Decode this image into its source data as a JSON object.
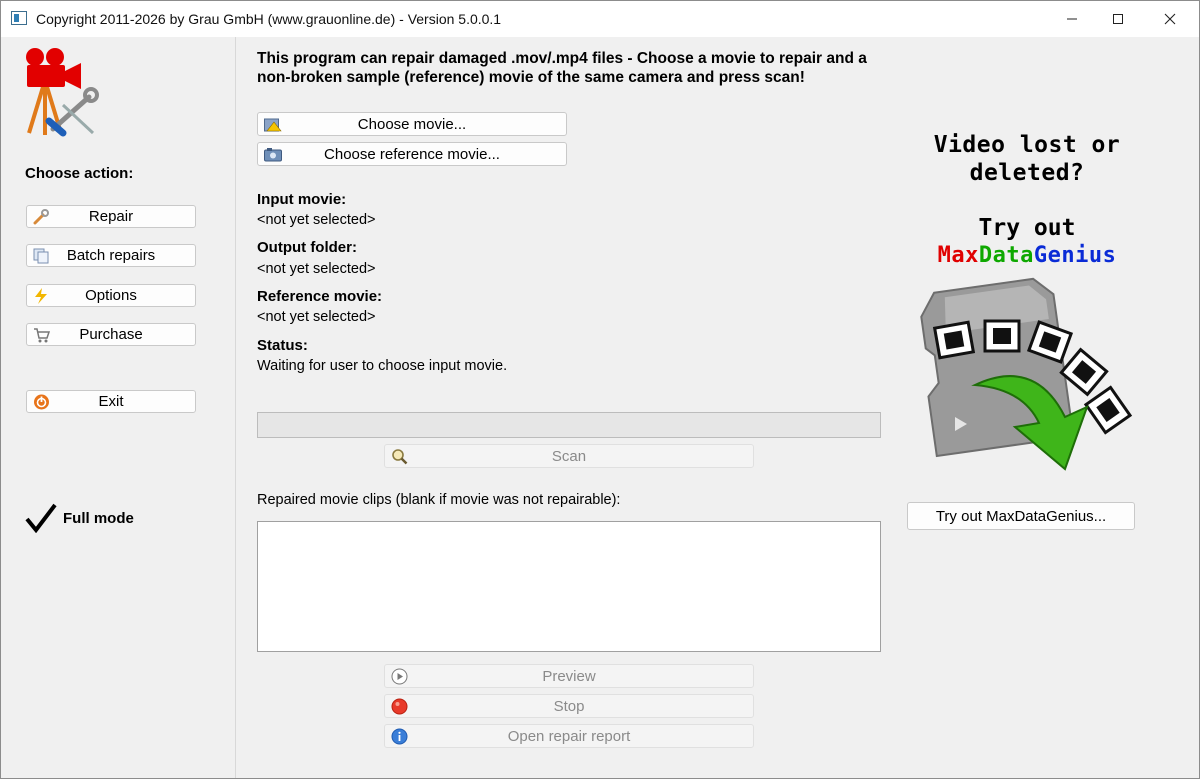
{
  "window": {
    "title": "Copyright 2011-2026 by Grau GmbH (www.grauonline.de) - Version 5.0.0.1",
    "controls": [
      "minimize",
      "maximize",
      "close"
    ]
  },
  "sidebar": {
    "logo_icon": "camera-tools-logo-icon",
    "choose_action_label": "Choose action:",
    "buttons": [
      {
        "label": "Repair",
        "icon": "wrench-icon"
      },
      {
        "label": "Batch repairs",
        "icon": "documents-stack-icon"
      },
      {
        "label": "Options",
        "icon": "lightning-icon"
      },
      {
        "label": "Purchase",
        "icon": "shopping-cart-icon"
      }
    ],
    "exit": {
      "label": "Exit",
      "icon": "power-icon"
    },
    "mode": {
      "label": "Full mode",
      "icon": "checkmark-icon"
    }
  },
  "main": {
    "intro": "This program can repair damaged .mov/.mp4 files - Choose a movie to repair and a non-broken sample (reference) movie of the same camera and press scan!",
    "choose_movie_label": "Choose movie...",
    "choose_reference_label": "Choose reference movie...",
    "fields": [
      {
        "label": "Input movie:",
        "value": "<not yet selected>"
      },
      {
        "label": "Output folder:",
        "value": "<not yet selected>"
      },
      {
        "label": "Reference movie:",
        "value": "<not yet selected>"
      },
      {
        "label": "Status:",
        "value": "Waiting for user to choose input movie."
      }
    ],
    "progress": 0,
    "scan_label": "Scan",
    "clips_label": "Repaired movie clips (blank if movie was not repairable):",
    "clips": [],
    "preview_label": "Preview",
    "stop_label": "Stop",
    "open_report_label": "Open repair report"
  },
  "promo": {
    "headline_line1": "Video lost or",
    "headline_line2": "deleted?",
    "try_out": "Try out",
    "brand": {
      "part1": "Max",
      "part2": "Data",
      "part3": "Genius",
      "color1": "#e00000",
      "color2": "#0ea800",
      "color3": "#0a2bd6"
    },
    "button_label": "Try out MaxDataGenius..."
  },
  "colors": {
    "background": "#f0f0f0",
    "button_face": "#fdfdfd",
    "disabled_text": "#8a8a8a"
  }
}
